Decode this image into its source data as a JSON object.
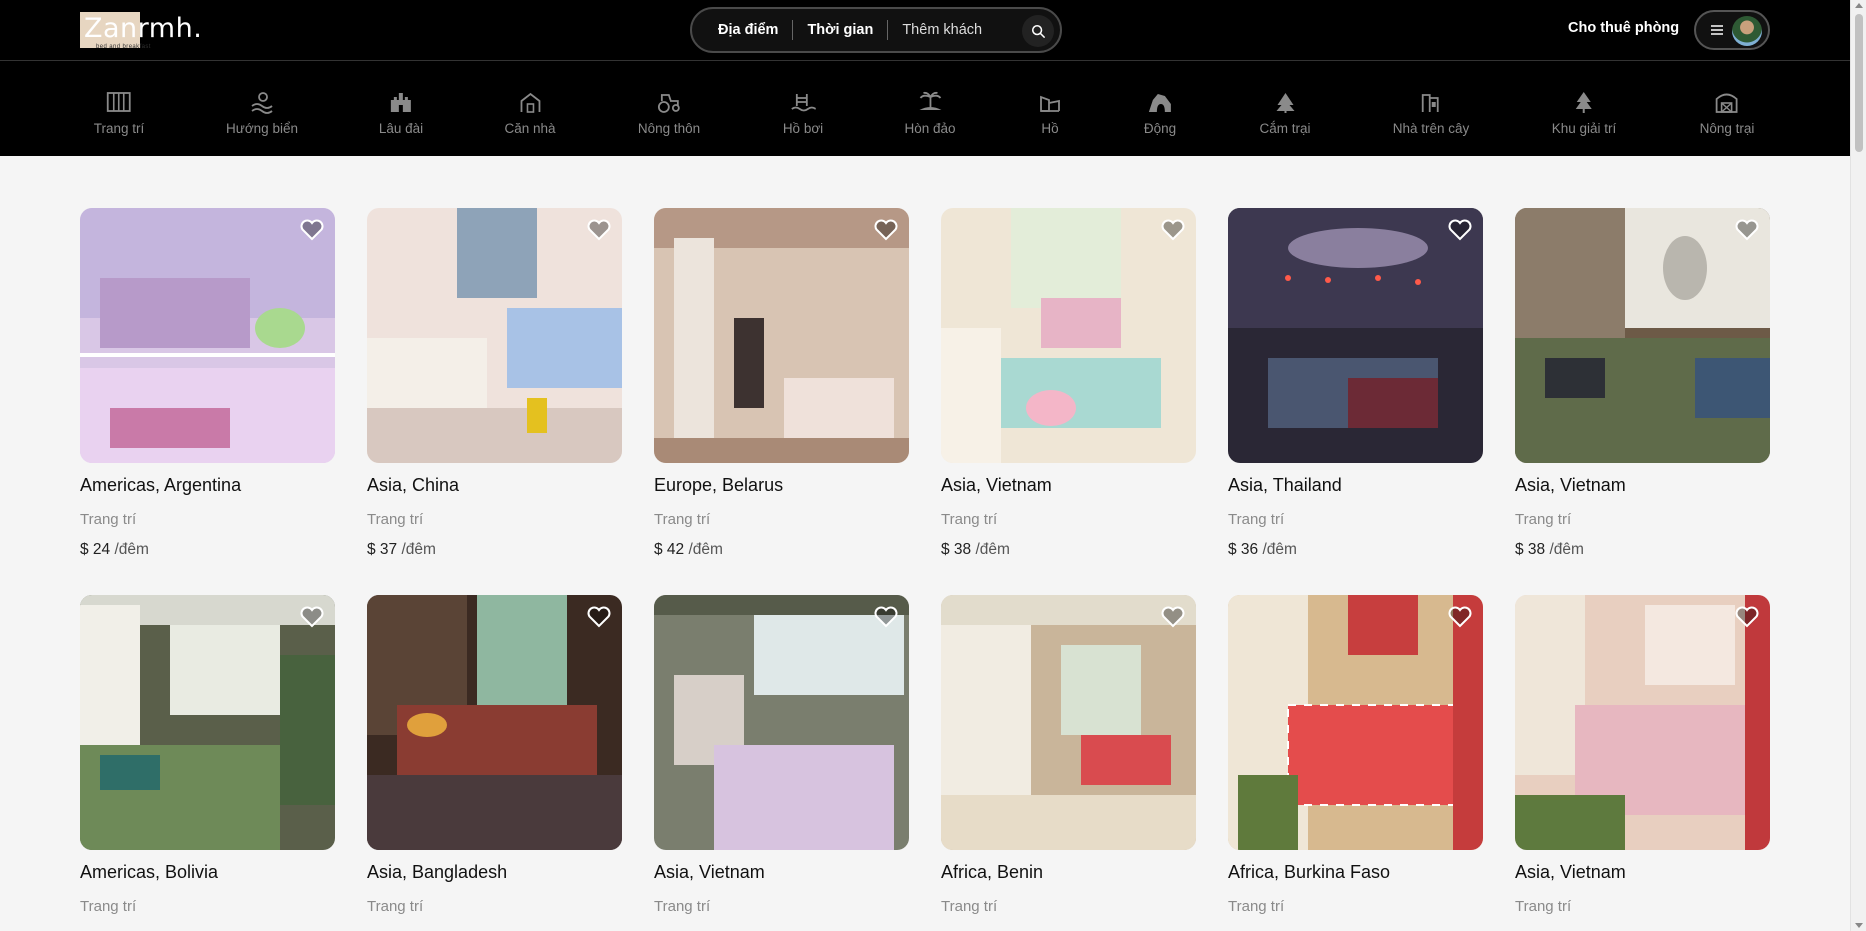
{
  "brand": {
    "logo_text": "Zanrmh.",
    "tagline": "bed and breakfast"
  },
  "search": {
    "location_label": "Địa điểm",
    "time_label": "Thời gian",
    "guests_label": "Thêm khách",
    "button_icon": "search-icon"
  },
  "header": {
    "host_link": "Cho thuê phòng",
    "menu_icon": "hamburger-menu-icon",
    "avatar_icon": "user-avatar"
  },
  "categories": [
    {
      "label": "Trang trí",
      "icon": "decor-icon"
    },
    {
      "label": "Hướng biển",
      "icon": "beach-icon"
    },
    {
      "label": "Lâu đài",
      "icon": "castle-icon"
    },
    {
      "label": "Căn nhà",
      "icon": "house-icon"
    },
    {
      "label": "Nông thôn",
      "icon": "tractor-icon"
    },
    {
      "label": "Hồ bơi",
      "icon": "pool-icon"
    },
    {
      "label": "Hòn đảo",
      "icon": "island-icon"
    },
    {
      "label": "Hồ",
      "icon": "lake-icon"
    },
    {
      "label": "Động",
      "icon": "cave-icon"
    },
    {
      "label": "Cắm trại",
      "icon": "camping-icon"
    },
    {
      "label": "Nhà trên cây",
      "icon": "treehouse-icon"
    },
    {
      "label": "Khu giải trí",
      "icon": "ski-icon"
    },
    {
      "label": "Nông trại",
      "icon": "barn-icon"
    }
  ],
  "listings": [
    {
      "title": "Americas, Argentina",
      "category": "Trang trí",
      "price": "$ 24",
      "unit": "/đêm"
    },
    {
      "title": "Asia, China",
      "category": "Trang trí",
      "price": "$ 37",
      "unit": "/đêm"
    },
    {
      "title": "Europe, Belarus",
      "category": "Trang trí",
      "price": "$ 42",
      "unit": "/đêm"
    },
    {
      "title": "Asia, Vietnam",
      "category": "Trang trí",
      "price": "$ 38",
      "unit": "/đêm"
    },
    {
      "title": "Asia, Thailand",
      "category": "Trang trí",
      "price": "$ 36",
      "unit": "/đêm"
    },
    {
      "title": "Asia, Vietnam",
      "category": "Trang trí",
      "price": "$ 38",
      "unit": "/đêm"
    },
    {
      "title": "Americas, Bolivia",
      "category": "Trang trí"
    },
    {
      "title": "Asia, Bangladesh",
      "category": "Trang trí"
    },
    {
      "title": "Asia, Vietnam",
      "category": "Trang trí"
    },
    {
      "title": "Africa, Benin",
      "category": "Trang trí"
    },
    {
      "title": "Africa, Burkina Faso",
      "category": "Trang trí"
    },
    {
      "title": "Asia, Vietnam",
      "category": "Trang trí"
    }
  ],
  "colors": {
    "header_bg": "#000000",
    "page_bg": "#f5f5f5",
    "muted_text": "#8a8a8a"
  }
}
